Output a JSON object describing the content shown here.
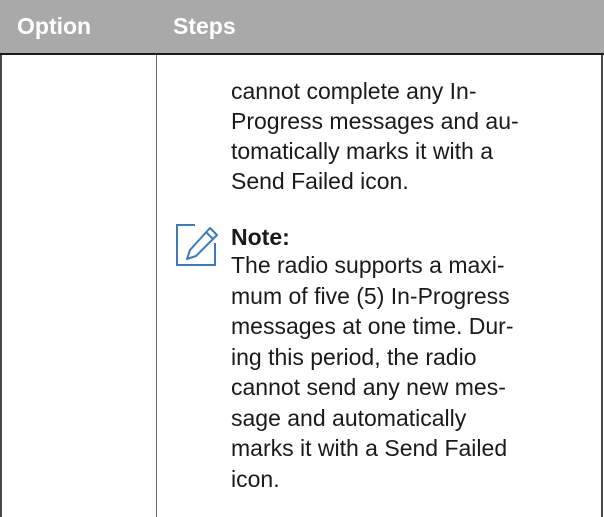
{
  "table": {
    "headers": {
      "option": "Option",
      "steps": "Steps"
    },
    "step_text": "cannot complete any In-\nProgress messages and au-\ntomatically marks it with a\nSend Failed icon.",
    "note": {
      "icon": "note-pencil-icon",
      "title": "Note:",
      "body": "The radio supports a maxi-\nmum of five (5) In-Progress\nmessages at one time. Dur-\ning this period, the radio\ncannot send any new mes-\nsage and automatically\nmarks it with a Send Failed\nicon."
    }
  },
  "colors": {
    "header_background": "#a9a9a9",
    "header_text": "#ffffff",
    "icon_stroke": "#3d7ab8"
  }
}
